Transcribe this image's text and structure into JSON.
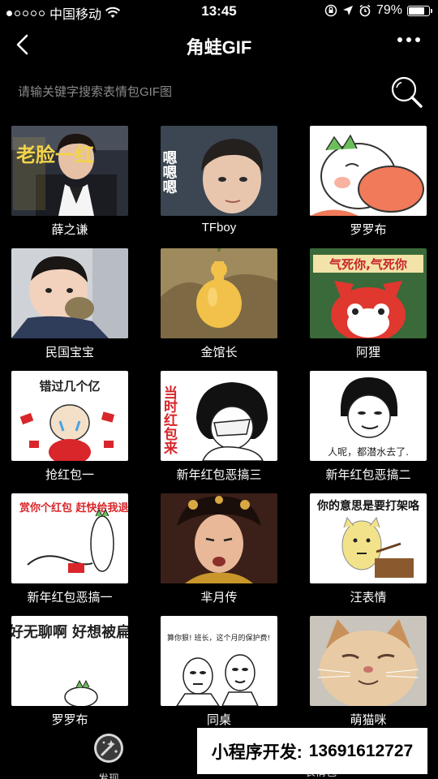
{
  "status_bar": {
    "carrier": "中国移动",
    "time": "13:45",
    "battery_label": "79%",
    "battery_level": 0.79
  },
  "nav": {
    "title": "角蛙GIF"
  },
  "search": {
    "placeholder": "请输关键字搜索表情包GIF图"
  },
  "items": [
    {
      "label": "薛之谦",
      "caption": "老脸一红"
    },
    {
      "label": "TFboy",
      "caption": "嗯嗯嗯"
    },
    {
      "label": "罗罗布",
      "caption": ""
    },
    {
      "label": "民国宝宝",
      "caption": ""
    },
    {
      "label": "金馆长",
      "caption": ""
    },
    {
      "label": "阿狸",
      "caption": "气死你,气死你"
    },
    {
      "label": "抢红包一",
      "caption": "错过几个亿"
    },
    {
      "label": "新年红包恶搞三",
      "caption": "当时红包来"
    },
    {
      "label": "新年红包恶搞二",
      "caption": "人呢，都潜水去了."
    },
    {
      "label": "新年红包恶搞一",
      "caption": "赏你个红包 赶快给我退下"
    },
    {
      "label": "芈月传",
      "caption": ""
    },
    {
      "label": "汪表情",
      "caption": "你的意思是要打架咯"
    },
    {
      "label": "罗罗布",
      "caption": "好无聊啊 好想被扁"
    },
    {
      "label": "同桌",
      "caption": "算你狠!  班长，这个月的保护费!"
    },
    {
      "label": "萌猫咪",
      "caption": ""
    }
  ],
  "tabbar": {
    "discover_label": "发现",
    "emoji_label": "表情包"
  },
  "promo": {
    "label": "小程序开发:",
    "phone": "13691612727"
  },
  "colors": {
    "background": "#000000",
    "text": "#ffffff",
    "placeholder": "#8a8a8a",
    "promo_bg": "#ffffff"
  }
}
